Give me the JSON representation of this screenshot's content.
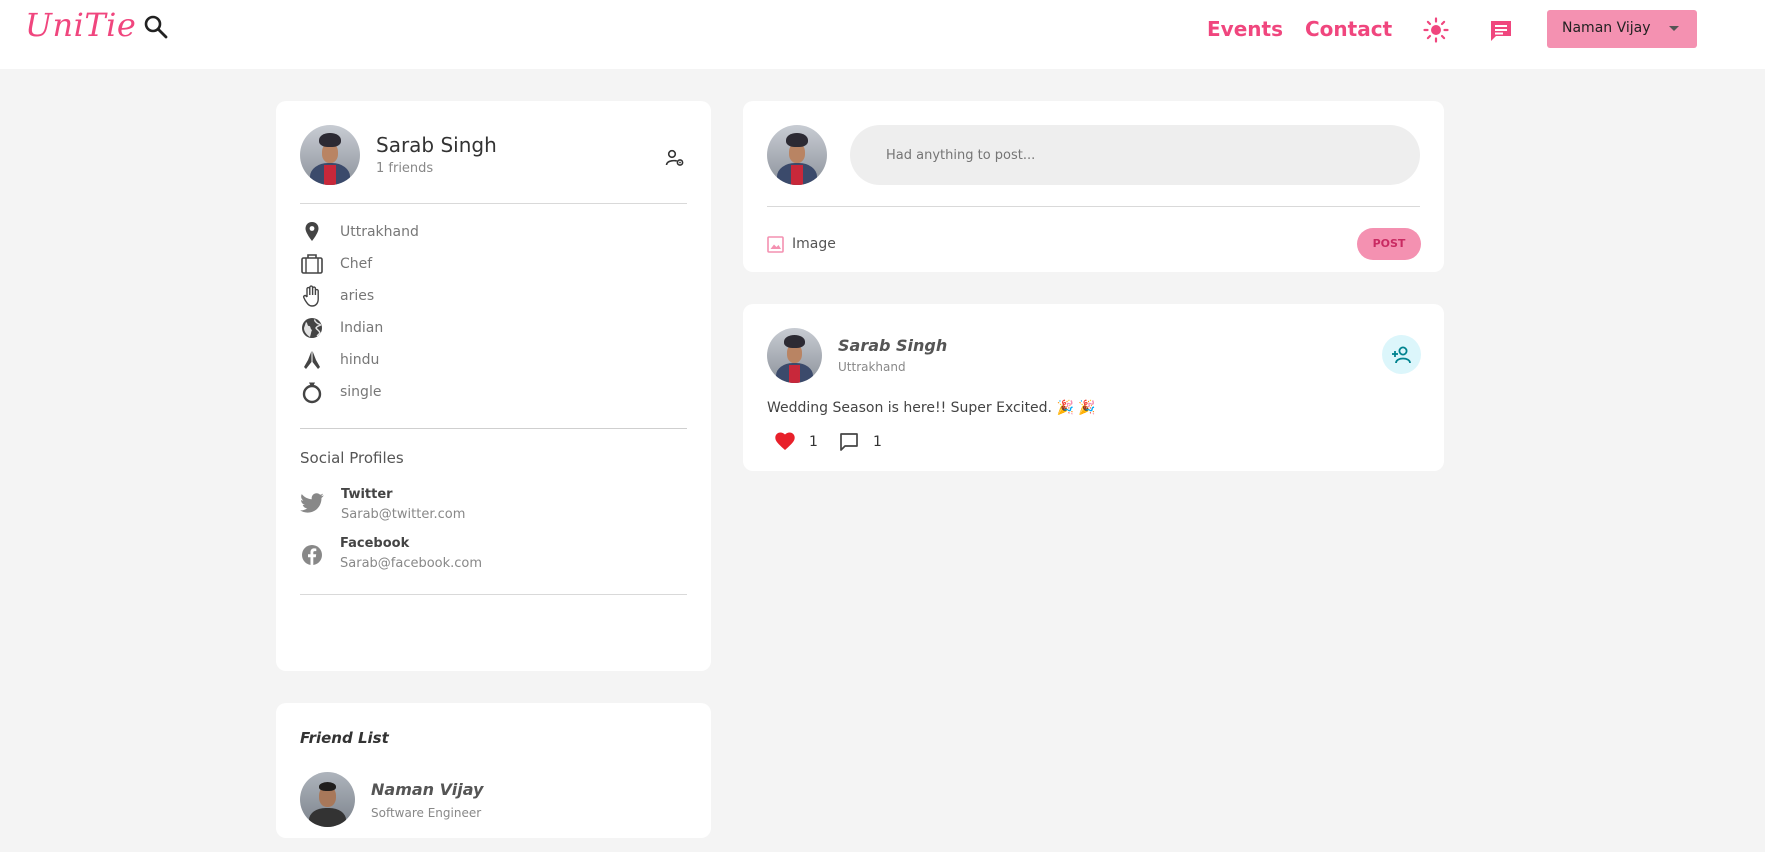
{
  "header": {
    "logo": "UniTie",
    "nav": {
      "events": "Events",
      "contact": "Contact"
    },
    "user_menu": {
      "label": "Naman Vijay"
    },
    "accent": "#f0467e"
  },
  "profile": {
    "name": "Sarab Singh",
    "friends": "1 friends",
    "details": [
      {
        "icon": "location-pin-icon",
        "text": "Uttrakhand"
      },
      {
        "icon": "briefcase-icon",
        "text": "Chef"
      },
      {
        "icon": "hand-icon",
        "text": "aries"
      },
      {
        "icon": "globe-icon",
        "text": "Indian"
      },
      {
        "icon": "praying-hands-icon",
        "text": "hindu"
      },
      {
        "icon": "ring-icon",
        "text": "single"
      }
    ],
    "social_title": "Social Profiles",
    "social": [
      {
        "icon": "twitter-icon",
        "name": "Twitter",
        "handle": "Sarab@twitter.com"
      },
      {
        "icon": "facebook-icon",
        "name": "Facebook",
        "handle": "Sarab@facebook.com"
      }
    ]
  },
  "friend_list": {
    "title": "Friend List",
    "friends": [
      {
        "name": "Naman Vijay",
        "role": "Software Engineer"
      }
    ]
  },
  "composer": {
    "placeholder": "Had anything to post...",
    "image_label": "Image",
    "post_label": "POST"
  },
  "post": {
    "author": "Sarab Singh",
    "location": "Uttrakhand",
    "text": "Wedding Season is here!! Super Excited. 🎉 🎉",
    "likes": "1",
    "comments": "1"
  }
}
